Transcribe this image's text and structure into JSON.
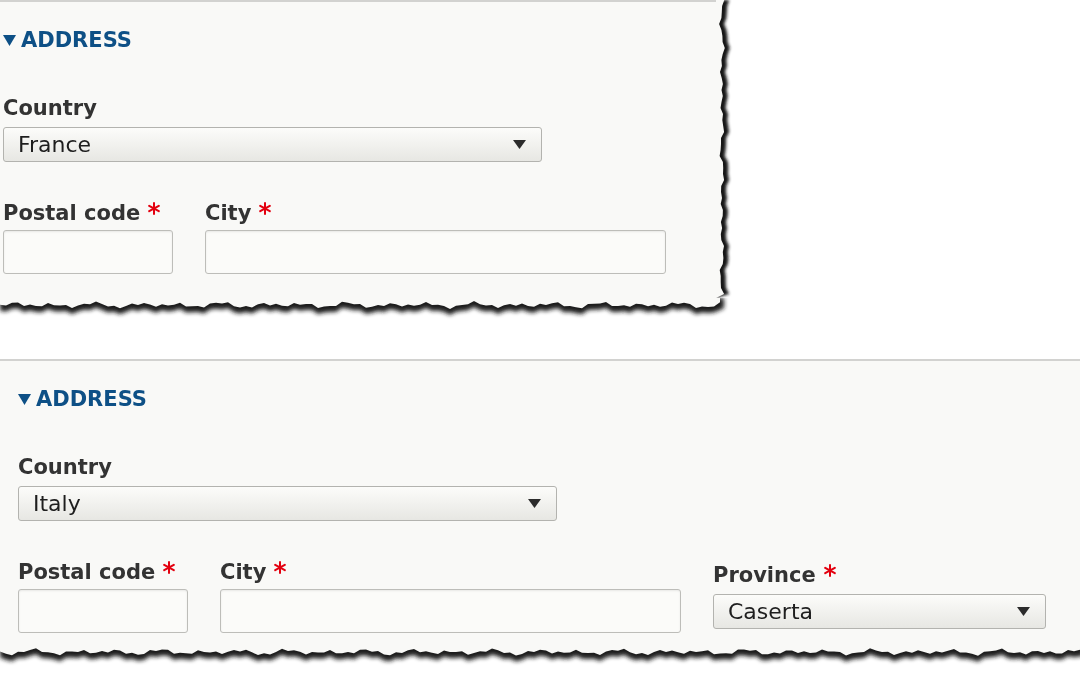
{
  "panels": [
    {
      "heading": "ADDRESS",
      "expanded": true,
      "rows": [
        {
          "fields": [
            {
              "kind": "select",
              "label": "Country",
              "value": "France",
              "required": false
            }
          ]
        },
        {
          "fields": [
            {
              "kind": "text",
              "label": "Postal code",
              "required": true
            },
            {
              "kind": "text",
              "label": "City",
              "required": true
            }
          ]
        }
      ]
    },
    {
      "heading": "ADDRESS",
      "expanded": true,
      "rows": [
        {
          "fields": [
            {
              "kind": "select",
              "label": "Country",
              "value": "Italy",
              "required": false
            }
          ]
        },
        {
          "fields": [
            {
              "kind": "text",
              "label": "Postal code",
              "required": true
            },
            {
              "kind": "text",
              "label": "City",
              "required": true
            },
            {
              "kind": "select",
              "label": "Province",
              "value": "Caserta",
              "required": true
            }
          ]
        }
      ]
    }
  ]
}
